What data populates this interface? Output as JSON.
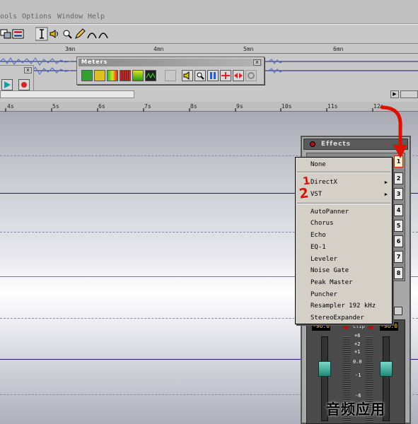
{
  "menubar": {
    "items": [
      "ools",
      "Options",
      "Window",
      "Help"
    ]
  },
  "overview_ruler": {
    "ticks": [
      "3mn",
      "4mn",
      "5mn",
      "6mn"
    ]
  },
  "main_ruler": {
    "ticks": [
      "4s",
      "5s",
      "6s",
      "7s",
      "8s",
      "9s",
      "10s",
      "11s",
      "12s"
    ]
  },
  "meters_panel": {
    "title": "Meters",
    "close": "x"
  },
  "mini_panel": {
    "close": "x"
  },
  "effects": {
    "title": "Effects",
    "slots": [
      "1",
      "2",
      "3",
      "4",
      "5",
      "6",
      "7",
      "8"
    ],
    "meter_left": "-96.0",
    "meter_right": "-96.0",
    "clip": "Clip",
    "scale": [
      "+6",
      "+2",
      "+1",
      "0.0",
      "-1",
      "-6"
    ]
  },
  "dropdown": {
    "items": [
      "None",
      "DirectX",
      "VST",
      "AutoPanner",
      "Chorus",
      "Echo",
      "EQ-1",
      "Leveler",
      "Noise Gate",
      "Peak Master",
      "Puncher",
      "Resampler 192 kHz",
      "StereoExpander"
    ],
    "submenu_arrow": "▶"
  },
  "annotations": {
    "mark1": "1",
    "mark2": "2"
  },
  "watermark": "音频应用",
  "colors": {
    "wave": "#1a1a6e",
    "accent_red": "#e01000",
    "fader": "#2ea894",
    "meter_text": "#ffd000"
  }
}
